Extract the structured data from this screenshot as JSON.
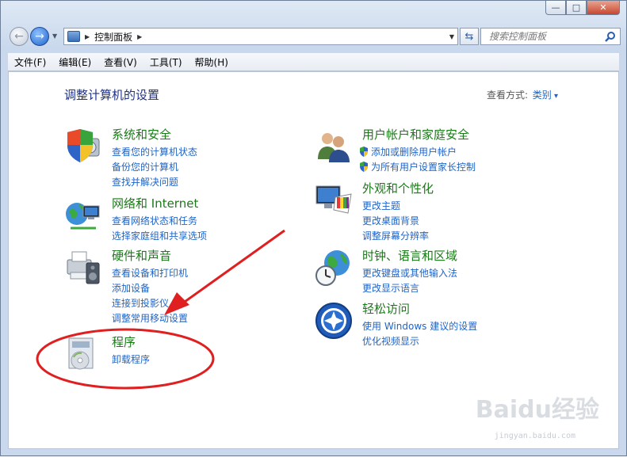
{
  "window": {
    "caption_buttons": [
      "minimize",
      "maximize",
      "close"
    ]
  },
  "navigation": {
    "breadcrumb": "控制面板",
    "search_placeholder": "搜索控制面板"
  },
  "menu": [
    "文件(F)",
    "编辑(E)",
    "查看(V)",
    "工具(T)",
    "帮助(H)"
  ],
  "content": {
    "title": "调整计算机的设置",
    "view_by_label": "查看方式:",
    "view_by_value": "类别"
  },
  "categories": [
    {
      "icon": "shield-computer-icon",
      "title": "系统和安全",
      "links": [
        "查看您的计算机状态",
        "备份您的计算机",
        "查找并解决问题"
      ]
    },
    {
      "icon": "network-globe-icon",
      "title": "网络和 Internet",
      "links": [
        "查看网络状态和任务",
        "选择家庭组和共享选项"
      ]
    },
    {
      "icon": "printer-speaker-icon",
      "title": "硬件和声音",
      "links": [
        "查看设备和打印机",
        "添加设备",
        "连接到投影仪",
        "调整常用移动设置"
      ]
    },
    {
      "icon": "programs-disc-icon",
      "title": "程序",
      "links": [
        "卸载程序"
      ]
    },
    {
      "icon": "users-icon",
      "title": "用户帐户和家庭安全",
      "links": [
        "添加或删除用户帐户",
        "为所有用户设置家长控制"
      ]
    },
    {
      "icon": "monitor-palette-icon",
      "title": "外观和个性化",
      "links": [
        "更改主题",
        "更改桌面背景",
        "调整屏幕分辨率"
      ]
    },
    {
      "icon": "clock-globe-icon",
      "title": "时钟、语言和区域",
      "links": [
        "更改键盘或其他输入法",
        "更改显示语言"
      ]
    },
    {
      "icon": "ease-of-access-icon",
      "title": "轻松访问",
      "links": [
        "使用 Windows 建议的设置",
        "优化视频显示"
      ]
    }
  ],
  "annotation": {
    "arrow_color": "#e02020",
    "ellipse_color": "#e02020"
  },
  "watermark": {
    "brand": "Baidu经验",
    "url": "jingyan.baidu.com"
  }
}
